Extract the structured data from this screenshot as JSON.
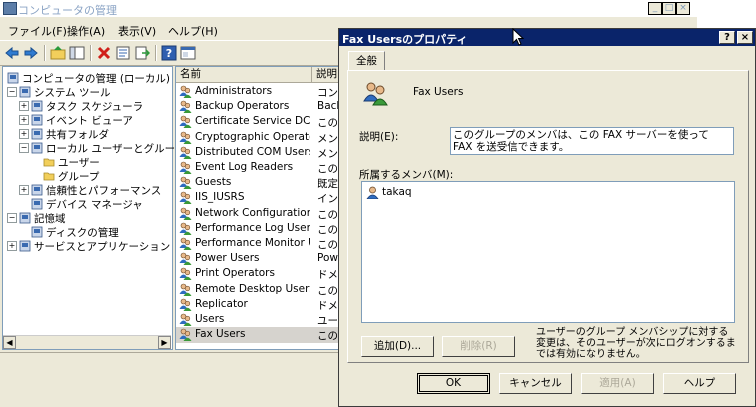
{
  "mmc": {
    "title": "コンピュータの管理",
    "window_buttons": {
      "minimize": "_",
      "maximize": "□",
      "close": "×"
    },
    "menu": [
      "ファイル(F)",
      "操作(A)",
      "表示(V)",
      "ヘルプ(H)"
    ],
    "toolbar_icons": [
      "back-arrow-icon",
      "forward-arrow-icon",
      "up-folder-icon",
      "show-tree-icon",
      "delete-icon",
      "properties-icon",
      "export-icon",
      "help-icon",
      "console-icon"
    ],
    "tree": [
      {
        "label": "コンピュータの管理 (ローカル)",
        "exp": "",
        "icon": "computer-icon"
      },
      {
        "label": "システム ツール",
        "exp": "−",
        "icon": "tools-icon"
      },
      {
        "label": "タスク スケジューラ",
        "exp": "+",
        "icon": "clock-icon"
      },
      {
        "label": "イベント ビューア",
        "exp": "+",
        "icon": "event-viewer-icon"
      },
      {
        "label": "共有フォルダ",
        "exp": "+",
        "icon": "shared-folder-icon"
      },
      {
        "label": "ローカル ユーザーとグループ",
        "exp": "−",
        "icon": "users-icon"
      },
      {
        "label": "ユーザー",
        "exp": "",
        "icon": "folder-icon"
      },
      {
        "label": "グループ",
        "exp": "",
        "icon": "folder-icon"
      },
      {
        "label": "信頼性とパフォーマンス",
        "exp": "+",
        "icon": "performance-icon"
      },
      {
        "label": "デバイス マネージャ",
        "exp": "",
        "icon": "device-manager-icon"
      },
      {
        "label": "記憶域",
        "exp": "−",
        "icon": "storage-icon"
      },
      {
        "label": "ディスクの管理",
        "exp": "",
        "icon": "disk-icon"
      },
      {
        "label": "サービスとアプリケーション",
        "exp": "+",
        "icon": "services-icon"
      }
    ],
    "list": {
      "columns": [
        "名前",
        "説明"
      ],
      "rows": [
        {
          "name": "Administrators",
          "desc": "コンピ"
        },
        {
          "name": "Backup Operators",
          "desc": "Back"
        },
        {
          "name": "Certificate Service DC...",
          "desc": "この"
        },
        {
          "name": "Cryptographic Operators",
          "desc": "メン"
        },
        {
          "name": "Distributed COM Users",
          "desc": "メン"
        },
        {
          "name": "Event Log Readers",
          "desc": "この"
        },
        {
          "name": "Guests",
          "desc": "既定"
        },
        {
          "name": "IIS_IUSRS",
          "desc": "イン"
        },
        {
          "name": "Network Configuration ...",
          "desc": "この"
        },
        {
          "name": "Performance Log Users",
          "desc": "この"
        },
        {
          "name": "Performance Monitor U...",
          "desc": "この"
        },
        {
          "name": "Power Users",
          "desc": "Pow"
        },
        {
          "name": "Print Operators",
          "desc": "ドメイ"
        },
        {
          "name": "Remote Desktop Users",
          "desc": "この"
        },
        {
          "name": "Replicator",
          "desc": "ドメイ"
        },
        {
          "name": "Users",
          "desc": "ユー"
        },
        {
          "name": "Fax Users",
          "desc": "この"
        }
      ],
      "selected_index": 16
    }
  },
  "dialog": {
    "title": "Fax Usersのプロパティ",
    "help_button": "?",
    "close_button": "×",
    "tab": "全般",
    "group_name": "Fax Users",
    "description_label": "説明(E):",
    "description_value": "このグループのメンバは、この FAX サーバーを使って FAX を送受信できます。",
    "members_label": "所属するメンバ(M):",
    "members": [
      "takaq"
    ],
    "add_button": "追加(D)...",
    "remove_button": "削除(R)",
    "note": "ユーザーのグループ メンバシップに対する変更は、そのユーザーが次にログオンするまでは有効になりません。",
    "ok_button": "OK",
    "cancel_button": "キャンセル",
    "apply_button": "適用(A)",
    "help_label": "ヘルプ"
  }
}
